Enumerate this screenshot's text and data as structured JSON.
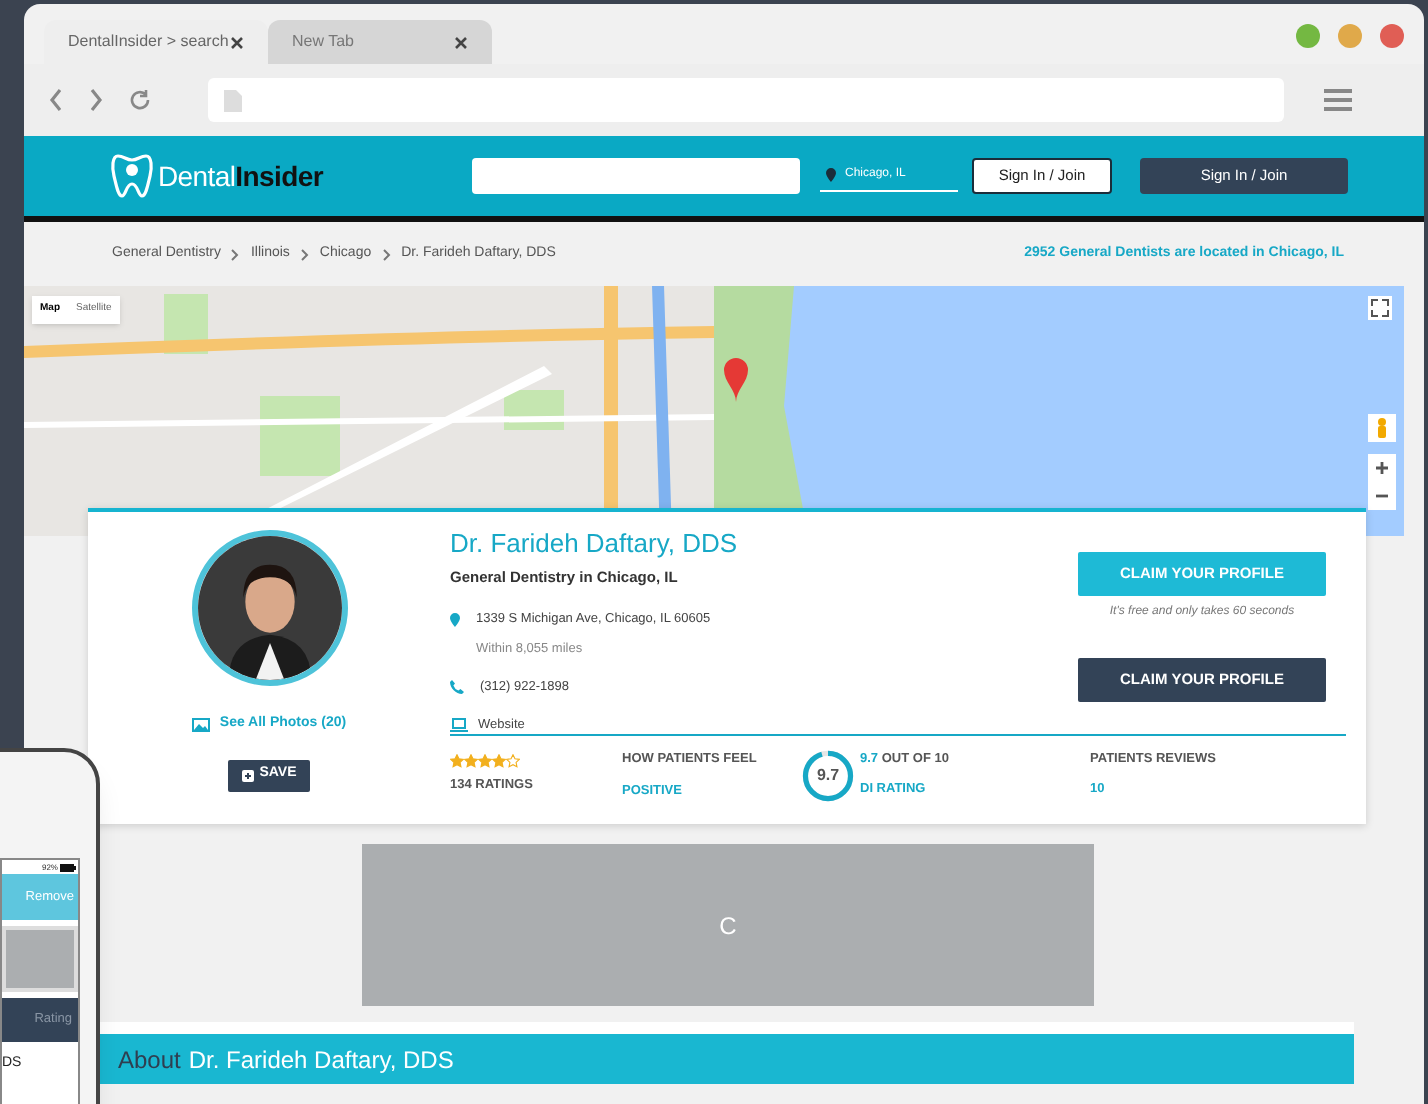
{
  "browser": {
    "tabs": [
      {
        "title": "DentalInsider > search",
        "selected": true
      },
      {
        "title": "New Tab",
        "selected": false
      }
    ]
  },
  "header": {
    "logo_light": "Dental",
    "logo_bold": "Insider",
    "location": "Chicago, IL",
    "buttons": [
      {
        "label": "Sign In / Join",
        "kind": "outline"
      },
      {
        "label": "Sign In / Join",
        "kind": "solid"
      }
    ]
  },
  "breadcrumb": [
    "General Dentistry",
    "Illinois",
    "Chicago",
    "Dr. Farideh Daftary, DDS"
  ],
  "count_note": "2952 General Dentists are located in Chicago, IL",
  "map": {
    "types": [
      {
        "label": "Map",
        "selected": true
      },
      {
        "label": "Satellite",
        "selected": false
      }
    ]
  },
  "profile": {
    "name": "Dr. Farideh Daftary, DDS",
    "specialty": "General Dentistry in Chicago, IL",
    "address": "1339 S Michigan Ave, Chicago, IL 60605",
    "distance": "Within 8,055 miles",
    "phone": "(312) 922-1898",
    "website": "Website",
    "photos_link": "See All Photos (20)",
    "save": "SAVE",
    "claim_buttons": [
      {
        "label": "CLAIM YOUR PROFILE",
        "kind": "teal"
      },
      {
        "label": "CLAIM YOUR PROFILE",
        "kind": "dark"
      }
    ],
    "claim_note": "It's free and only takes 60 seconds",
    "stars": 4,
    "ratings": "134 RATINGS",
    "feel_label": "HOW PATIENTS FEEL",
    "feel_value": "POSITIVE",
    "score": {
      "ring_text": "9.7",
      "level": 0.95,
      "value": "9.7",
      "out_of": "OUT OF 10",
      "label": "DI RATING"
    },
    "reviews_label": "PATIENTS REVIEWS",
    "reviews_value": "10"
  },
  "ad": {
    "text": "C"
  },
  "about": {
    "prefix": "About",
    "name": "Dr. Farideh Daftary, DDS"
  },
  "phone": {
    "battery": "92%",
    "action": "Remove",
    "column": "Rating",
    "row": "DS"
  }
}
